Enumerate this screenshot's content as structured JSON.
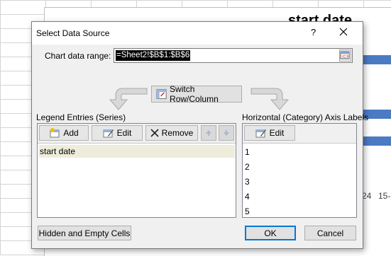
{
  "background": {
    "chart_title": "start date",
    "axis_ticks": [
      "24",
      "15-"
    ]
  },
  "dialog": {
    "title": "Select Data Source",
    "help": "?",
    "close": "✕",
    "range_label": "Chart data range:",
    "range_value": "=Sheet2!$B$1:$B$6",
    "switch_label": "Switch Row/Column",
    "legend_label": "Legend Entries (Series)",
    "axis_label": "Horizontal (Category) Axis Labels",
    "add_label": "Add",
    "edit_label": "Edit",
    "remove_label": "Remove",
    "axis_edit_label": "Edit",
    "series": [
      "start date"
    ],
    "categories": [
      "1",
      "2",
      "3",
      "4",
      "5"
    ],
    "hidden_cells_label": "Hidden and Empty Cells",
    "ok_label": "OK",
    "cancel_label": "Cancel"
  },
  "colors": {
    "bar": "#4a7bc3",
    "selected_row": "#eeeddb",
    "default_button_border": "#0078d7"
  }
}
